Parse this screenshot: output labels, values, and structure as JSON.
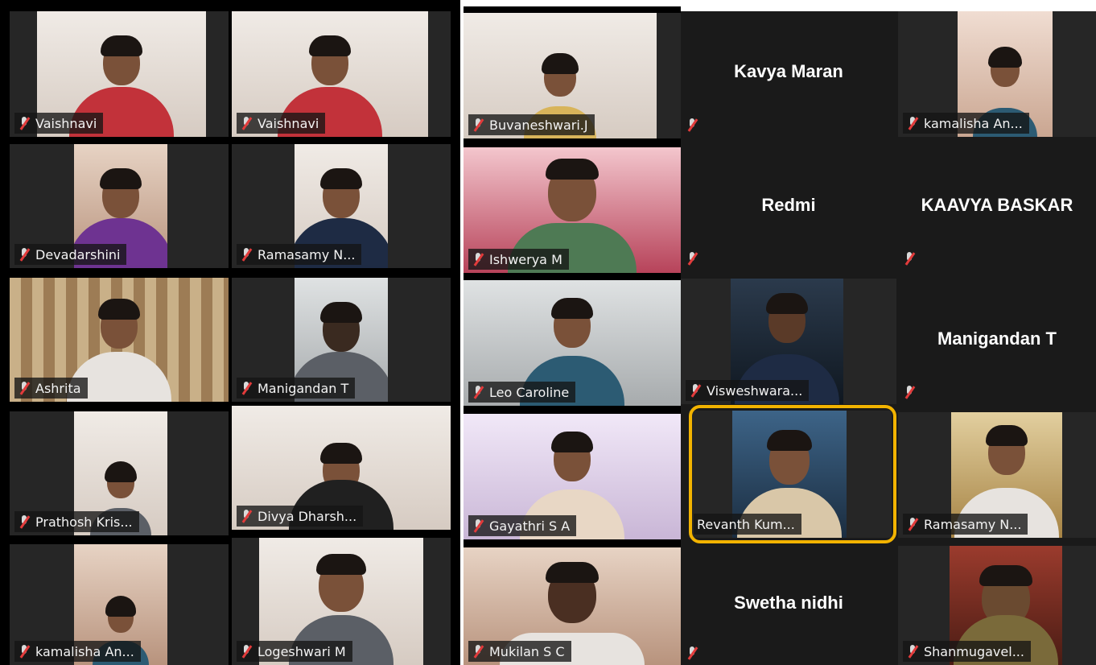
{
  "participants": {
    "vaishnavi_1": "Vaishnavi",
    "vaishnavi_2": "Vaishnavi",
    "buvaneshwari": "Buvaneshwari.J",
    "kavya_maran": "Kavya Maran",
    "kamalisha_top": "kamalisha An...",
    "devadarshini": "Devadarshini",
    "ramasamy_1": "Ramasamy N...",
    "ishwerya": "Ishwerya M",
    "redmi": "Redmi",
    "kaavya_baskar": "KAAVYA BASKAR",
    "ashrita": "Ashrita",
    "manigandan_video": "Manigandan T",
    "leo_caroline": "Leo Caroline",
    "visweshwara": "Visweshwara...",
    "manigandan_name": "Manigandan T",
    "prathosh": "Prathosh Kris...",
    "divya": "Divya Dharsh...",
    "gayathri": "Gayathri S A",
    "revanth": "Revanth Kum...",
    "ramasamy_2": "Ramasamy N...",
    "kamalisha_bottom": "kamalisha An...",
    "logeshwari": "Logeshwari M",
    "mukilan": "Mukilan S C",
    "swetha_nidhi": "Swetha nidhi",
    "shanmugavel": "Shanmugavel..."
  },
  "icons": {
    "muted_mic": "microphone-muted-icon"
  },
  "colors": {
    "tile_background": "#1a1a1a",
    "active_speaker_highlight": "#f2b300",
    "mute_red": "#e23b3b"
  }
}
